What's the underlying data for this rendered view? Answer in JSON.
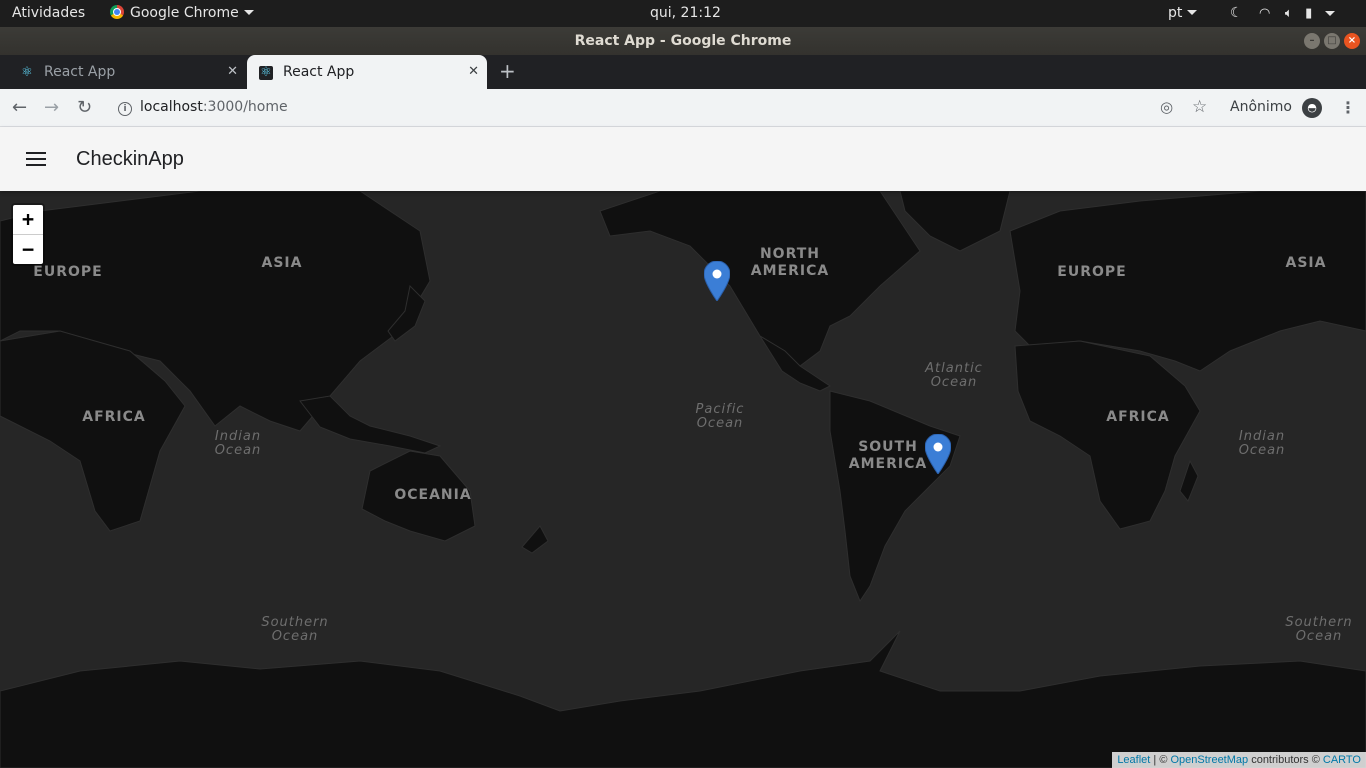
{
  "os_bar": {
    "activities": "Atividades",
    "app_menu": "Google Chrome",
    "clock": "qui, 21:12",
    "lang": "pt"
  },
  "window": {
    "title": "React App - Google Chrome"
  },
  "tabs": [
    {
      "label": "React App",
      "active": false
    },
    {
      "label": "React App",
      "active": true
    }
  ],
  "address": {
    "host": "localhost",
    "path": ":3000/home"
  },
  "profile": {
    "label": "Anônimo"
  },
  "app": {
    "title": "CheckinApp"
  },
  "map": {
    "zoom_in": "+",
    "zoom_out": "−",
    "continents": {
      "europe": "EUROPE",
      "asia": "ASIA",
      "north_america": "NORTH\nAMERICA",
      "africa": "AFRICA",
      "south_america": "SOUTH\nAMERICA",
      "oceania": "OCEANIA",
      "europe_2": "EUROPE",
      "asia_2": "ASIA",
      "africa_2": "AFRICA"
    },
    "oceans": {
      "pacific": "Pacific\nOcean",
      "atlantic": "Atlantic\nOcean",
      "indian": "Indian\nOcean",
      "indian_2": "Indian\nOcean",
      "southern": "Southern\nOcean",
      "southern_2": "Southern\nOcean"
    },
    "marker_color": "#3b7ed6",
    "attribution": {
      "leaflet": "Leaflet",
      "sep": " | © ",
      "osm": "OpenStreetMap",
      "contrib": " contributors © ",
      "carto": "CARTO"
    }
  }
}
